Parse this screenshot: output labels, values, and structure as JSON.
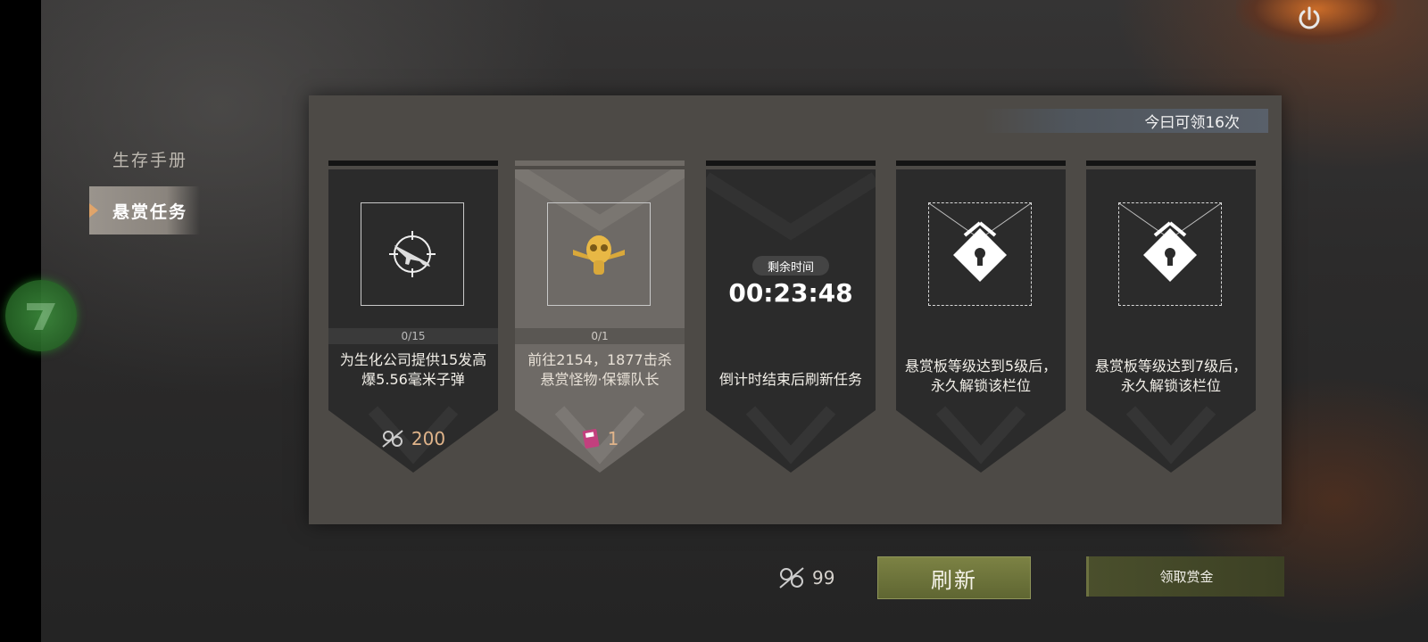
{
  "header": {
    "daily_claims": "今曰可领16次"
  },
  "sidebar": {
    "items": [
      {
        "label": "生存手册"
      },
      {
        "label": "悬赏任务"
      }
    ]
  },
  "cards": [
    {
      "progress": "0/15",
      "description": "为生化公司提供15发高爆5.56毫米子弹",
      "reward_amount": "200",
      "icon": "rifle-crosshair-icon",
      "reward_icon": "scrap-parts-icon"
    },
    {
      "progress": "0/1",
      "description": "前往2154，1877击杀悬赏怪物·保镖队长",
      "reward_amount": "1",
      "icon": "gold-gasmask-emblem-icon",
      "reward_icon": "pink-ticket-icon"
    },
    {
      "timer_label": "剩余时间",
      "timer_value": "00:23:48",
      "description": "倒计时结束后刷新任务"
    },
    {
      "description": "悬赏板等级达到5级后，永久解锁该栏位",
      "icon": "lock-icon"
    },
    {
      "description": "悬赏板等级达到7级后，永久解锁该栏位",
      "icon": "lock-icon"
    }
  ],
  "footer": {
    "currency_amount": "99",
    "currency_icon": "scrap-parts-icon",
    "refresh_label": "刷新",
    "claim_label": "领取赏金"
  },
  "colors": {
    "accent_green": "#6f7539",
    "panel": "#4d4a46",
    "reward_text": "#e0b48a"
  }
}
